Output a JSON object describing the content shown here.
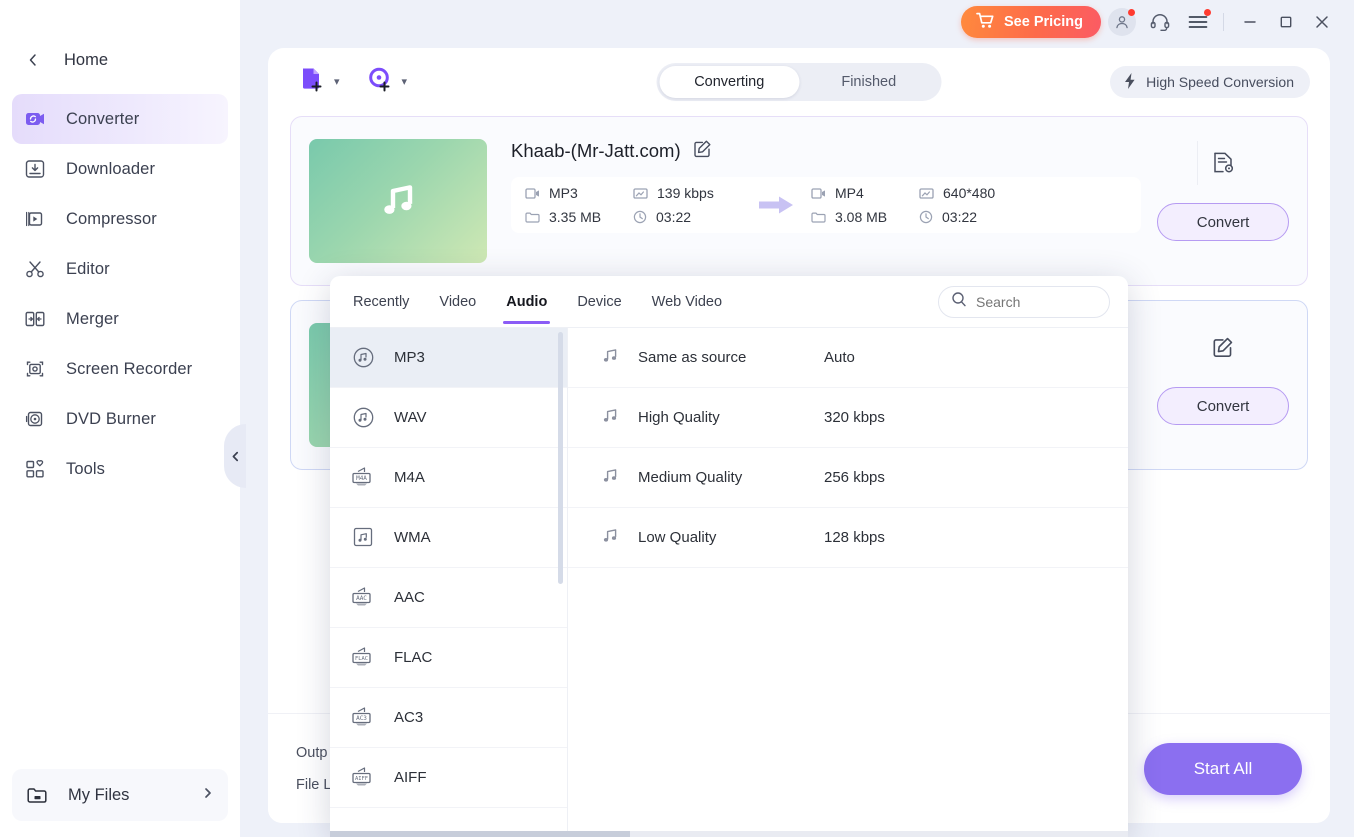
{
  "titlebar": {
    "pricing_label": "See Pricing",
    "cart_icon": "cart-icon",
    "account_icon": "account-icon",
    "support_icon": "headset-icon",
    "menu_icon": "hamburger-menu-icon",
    "minimize_icon": "minimize-icon",
    "maximize_icon": "maximize-icon",
    "close_icon": "close-icon"
  },
  "sidebar": {
    "home_label": "Home",
    "back_icon": "chevron-left-icon",
    "items": [
      {
        "label": "Converter",
        "icon": "converter-icon",
        "active": true
      },
      {
        "label": "Downloader",
        "icon": "download-icon",
        "active": false
      },
      {
        "label": "Compressor",
        "icon": "compressor-icon",
        "active": false
      },
      {
        "label": "Editor",
        "icon": "scissors-icon",
        "active": false
      },
      {
        "label": "Merger",
        "icon": "merger-icon",
        "active": false
      },
      {
        "label": "Screen Recorder",
        "icon": "screen-recorder-icon",
        "active": false
      },
      {
        "label": "DVD Burner",
        "icon": "dvd-icon",
        "active": false
      },
      {
        "label": "Tools",
        "icon": "tools-grid-icon",
        "active": false
      }
    ],
    "my_files_label": "My Files",
    "my_files_icon": "folder-icon",
    "my_files_arrow": "chevron-right-icon",
    "collapse_icon": "chevron-left-icon"
  },
  "toolbar": {
    "add_file_icon": "add-file-icon",
    "add_disc_icon": "add-disc-icon",
    "dropdown_icon": "chevron-down-icon",
    "tabs": [
      {
        "label": "Converting",
        "active": true
      },
      {
        "label": "Finished",
        "active": false
      }
    ],
    "high_speed_label": "High Speed Conversion",
    "high_speed_icon": "lightning-icon"
  },
  "cards": [
    {
      "title": "Khaab-(Mr-Jatt.com)",
      "edit_icon": "edit-pencil-icon",
      "thumb_icon": "music-note-icon",
      "source": {
        "format": "MP3",
        "bitrate": "139 kbps",
        "size": "3.35 MB",
        "duration": "03:22"
      },
      "target": {
        "format": "MP4",
        "resolution": "640*480",
        "size": "3.08 MB",
        "duration": "03:22"
      },
      "arrow_icon": "arrow-right-icon",
      "settings_icon": "file-settings-icon",
      "convert_label": "Convert",
      "format_icon": "video-format-icon",
      "quality_icon": "resolution-icon",
      "size_icon": "folder-small-icon",
      "duration_icon": "clock-icon"
    },
    {
      "title": "",
      "edit_icon": "edit-pencil-icon",
      "thumb_icon": "music-note-icon",
      "convert_label": "Convert"
    }
  ],
  "bottom": {
    "output_label": "Outp",
    "file_location_label": "File L",
    "start_all_label": "Start All"
  },
  "format_panel": {
    "tabs": [
      {
        "label": "Recently",
        "active": false
      },
      {
        "label": "Video",
        "active": false
      },
      {
        "label": "Audio",
        "active": true
      },
      {
        "label": "Device",
        "active": false
      },
      {
        "label": "Web Video",
        "active": false
      }
    ],
    "search_placeholder": "Search",
    "search_value": "",
    "search_icon": "search-icon",
    "formats": [
      {
        "label": "MP3",
        "icon": "mp3-disc-icon",
        "selected": true
      },
      {
        "label": "WAV",
        "icon": "wav-disc-icon",
        "selected": false
      },
      {
        "label": "M4A",
        "icon": "m4a-tag-icon",
        "selected": false
      },
      {
        "label": "WMA",
        "icon": "wma-square-icon",
        "selected": false
      },
      {
        "label": "AAC",
        "icon": "aac-tag-icon",
        "selected": false
      },
      {
        "label": "FLAC",
        "icon": "flac-tag-icon",
        "selected": false
      },
      {
        "label": "AC3",
        "icon": "ac3-tag-icon",
        "selected": false
      },
      {
        "label": "AIFF",
        "icon": "aiff-tag-icon",
        "selected": false
      }
    ],
    "qualities": [
      {
        "name": "Same as source",
        "value": "Auto",
        "icon": "music-note-icon"
      },
      {
        "name": "High Quality",
        "value": "320 kbps",
        "icon": "music-note-icon"
      },
      {
        "name": "Medium Quality",
        "value": "256 kbps",
        "icon": "music-note-icon"
      },
      {
        "name": "Low Quality",
        "value": "128 kbps",
        "icon": "music-note-icon"
      }
    ]
  },
  "colors": {
    "accent_purple": "#8b5cf6",
    "start_all_purple": "#8b6ff0",
    "pricing_gradient_start": "#ff8a3d",
    "pricing_gradient_end": "#fb5b64",
    "app_background": "#eef1f9",
    "thumb_gradient_start": "#79c9ac",
    "thumb_gradient_end": "#cfe8b4",
    "badge_red": "#ff3b30"
  }
}
